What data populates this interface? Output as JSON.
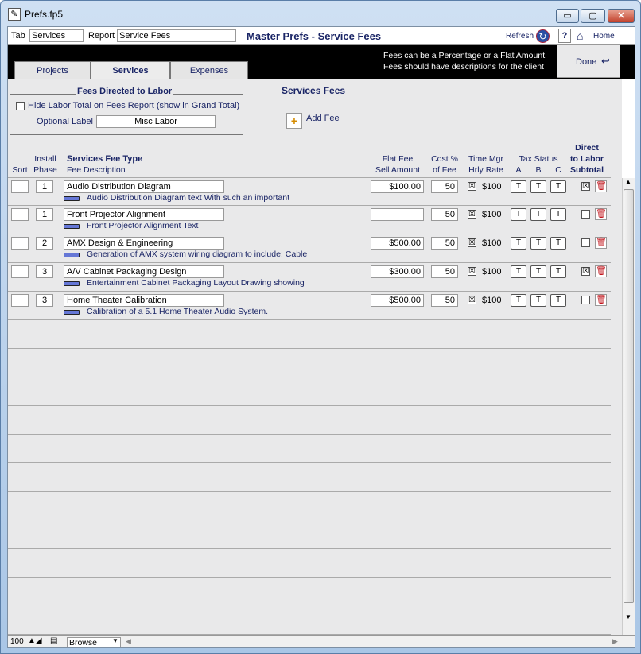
{
  "window": {
    "title": "Prefs.fp5",
    "min_symbol": "▭",
    "max_symbol": "▢",
    "close_symbol": "✕"
  },
  "topbar": {
    "tab_label": "Tab",
    "tab_value": "Services",
    "report_label": "Report",
    "report_value": "Service Fees",
    "title": "Master Prefs - Service Fees",
    "refresh_label": "Refresh",
    "help_label": "?",
    "home_label": "Home"
  },
  "tabs": [
    {
      "label": "Projects"
    },
    {
      "label": "Services"
    },
    {
      "label": "Expenses"
    }
  ],
  "notes": [
    "Fees can be a Percentage or a Flat Amount",
    "Fees should have descriptions for the client"
  ],
  "done": {
    "label": "Done"
  },
  "labor": {
    "section_title": "Fees Directed to Labor",
    "hide_label": "Hide Labor Total on Fees Report (show in Grand Total)",
    "optional_label": "Optional Label",
    "optional_value": "Misc Labor"
  },
  "services": {
    "section_title": "Services Fees",
    "add_fee_label": "Add Fee"
  },
  "headers": {
    "sort": "Sort",
    "install": "Install",
    "phase": "Phase",
    "fee_type": "Services Fee Type",
    "fee_desc": "Fee Description",
    "flat_fee": "Flat Fee",
    "sell_amount": "Sell Amount",
    "cost_pct": "Cost %",
    "of_fee": "of Fee",
    "time_mgr": "Time Mgr",
    "hrly_rate": "Hrly Rate",
    "tax_status": "Tax Status",
    "tax_a": "A",
    "tax_b": "B",
    "tax_c": "C",
    "direct": "Direct",
    "to_labor": "to Labor",
    "subtotal": "Subtotal"
  },
  "rows": [
    {
      "sort": "",
      "phase": "1",
      "name": "Audio Distribution Diagram",
      "desc": "Audio Distribution Diagram text  With such an important",
      "flat_fee": "$100.00",
      "cost_pct": "50",
      "time_mgr": "☒",
      "rate": "$100",
      "tax_a": "T",
      "tax_b": "T",
      "tax_c": "T",
      "labor": "☒"
    },
    {
      "sort": "",
      "phase": "1",
      "name": "Front Projector Alignment",
      "desc": "Front Projector Alignment Text",
      "flat_fee": "",
      "cost_pct": "50",
      "time_mgr": "☒",
      "rate": "$100",
      "tax_a": "T",
      "tax_b": "T",
      "tax_c": "T",
      "labor": ""
    },
    {
      "sort": "",
      "phase": "2",
      "name": "AMX Design & Engineering",
      "desc": "Generation of AMX system wiring diagram to include: Cable",
      "flat_fee": "$500.00",
      "cost_pct": "50",
      "time_mgr": "☒",
      "rate": "$100",
      "tax_a": "T",
      "tax_b": "T",
      "tax_c": "T",
      "labor": ""
    },
    {
      "sort": "",
      "phase": "3",
      "name": "A/V Cabinet Packaging Design",
      "desc": "Entertainment Cabinet Packaging Layout Drawing showing",
      "flat_fee": "$300.00",
      "cost_pct": "50",
      "time_mgr": "☒",
      "rate": "$100",
      "tax_a": "T",
      "tax_b": "T",
      "tax_c": "T",
      "labor": "☒"
    },
    {
      "sort": "",
      "phase": "3",
      "name": "Home Theater Calibration",
      "desc": "Calibration of a 5.1 Home Theater Audio System.",
      "flat_fee": "$500.00",
      "cost_pct": "50",
      "time_mgr": "☒",
      "rate": "$100",
      "tax_a": "T",
      "tax_b": "T",
      "tax_c": "T",
      "labor": ""
    }
  ],
  "statusbar": {
    "zoom": "100",
    "mode": "Browse"
  },
  "colors": {
    "header_text": "#1a2566",
    "panel_bg": "#e9e9ea",
    "trash": "#c0151c"
  }
}
